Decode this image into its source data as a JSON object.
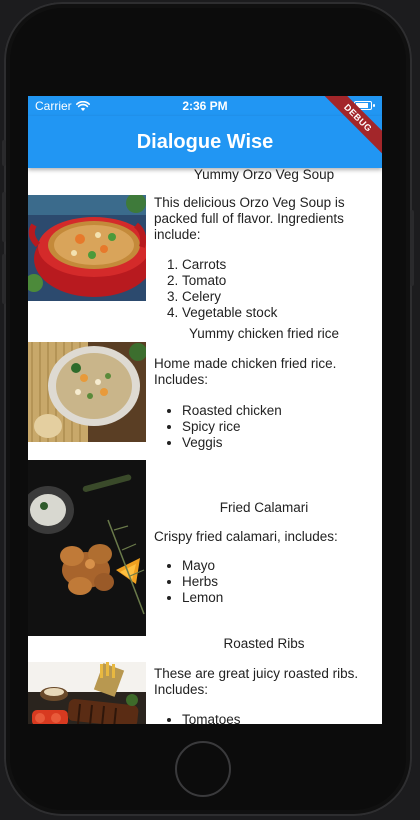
{
  "status_bar": {
    "carrier": "Carrier",
    "time": "2:36 PM"
  },
  "app_bar": {
    "title": "Dialogue Wise"
  },
  "debug_banner": "DEBUG",
  "colors": {
    "app_bar": "#2196f3",
    "debug": "#a3262a",
    "text": "#222222",
    "screen": "#ffffff"
  },
  "recipes": [
    {
      "title": "Yummy Orzo Veg Soup",
      "description": "This delicious Orzo Veg Soup is packed full of flavor. Ingredients include:",
      "list_style": "numbered",
      "ingredients": [
        "Carrots",
        "Tomato",
        "Celery",
        "Vegetable stock"
      ],
      "image": "orzo-veg-soup-photo"
    },
    {
      "title": "Yummy chicken fried rice",
      "description": "Home made chicken fried rice. Includes:",
      "list_style": "bullet",
      "ingredients": [
        "Roasted chicken",
        "Spicy rice",
        "Veggis"
      ],
      "image": "chicken-fried-rice-photo"
    },
    {
      "title": "Fried Calamari",
      "description": "Crispy fried calamari, includes:",
      "list_style": "bullet",
      "ingredients": [
        "Mayo",
        "Herbs",
        "Lemon"
      ],
      "image": "fried-calamari-photo"
    },
    {
      "title": "Roasted Ribs",
      "description": "These are great juicy roasted ribs. Includes:",
      "list_style": "bullet",
      "ingredients": [
        "Tomatoes"
      ],
      "image": "roasted-ribs-photo"
    }
  ]
}
